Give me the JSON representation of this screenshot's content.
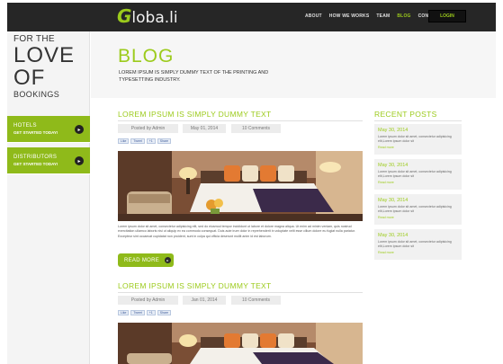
{
  "brand": {
    "logo_first": "G",
    "logo_rest": "loba.li"
  },
  "nav": {
    "items": [
      {
        "label": "ABOUT"
      },
      {
        "label": "HOW WE WORKS"
      },
      {
        "label": "TEAM"
      },
      {
        "label": "BLOG"
      },
      {
        "label": "CONTACT US"
      }
    ],
    "active": "BLOG",
    "login": "LOGIN"
  },
  "sidebar": {
    "line1": "FOR THE",
    "line2": "LOVE",
    "line3": "OF",
    "line4": "BOOKINGS",
    "buttons": [
      {
        "title": "HOTELS",
        "subtitle": "GET STARTED TODAY!",
        "icon": "arrow-right-icon"
      },
      {
        "title": "DISTRIBUTORS",
        "subtitle": "GET STARTED TODAY!",
        "icon": "arrow-right-icon"
      }
    ]
  },
  "header": {
    "title": "BLOG",
    "subtitle": "LOREM IPSUM IS SIMPLY DUMMY TEXT OF THE PRINTING AND TYPESETTING INDUSTRY."
  },
  "posts": [
    {
      "title": "LOREM IPSUM IS SIMPLY DUMMY TEXT",
      "author": "Posted by Admin",
      "date": "May 01, 2014",
      "comments": "10 Comments",
      "share": [
        "Like",
        "Tweet",
        "+1",
        "Share"
      ],
      "excerpt": "Lorem ipsum dolor sit amet, consectetur adipisicing elit, sed do eiusmod tempor incididunt ut labore et dolore magna aliqua. Ut enim ad minim veniam, quis nostrud exercitation ullamco laboris nisi ut aliquip ex ea commodo consequat. Duis aute irure dolor in reprehenderit in voluptate velit esse cillum dolore eu fugiat nulla pariatur. Excepteur sint occaecat cupidatat non proident, sunt in culpa qui officia deserunt mollit anim id est laborum.",
      "read_more": "READ MORE"
    },
    {
      "title": "LOREM IPSUM IS SIMPLY DUMMY TEXT",
      "author": "Posted by Admin",
      "date": "Jan 01, 2014",
      "comments": "10 Comments",
      "share": [
        "Like",
        "Tweet",
        "+1",
        "Share"
      ]
    }
  ],
  "recent": {
    "title": "RECENT POSTS",
    "items": [
      {
        "date": "May 30, 2014",
        "text": "Lorem ipsum dolor sit amet, consectetur adipisicing elit,Lorem ipsum dolor sit",
        "more": "Read more"
      },
      {
        "date": "May 30, 2014",
        "text": "Lorem ipsum dolor sit amet, consectetur adipisicing elit,Lorem ipsum dolor sit",
        "more": "Read more"
      },
      {
        "date": "May 30, 2014",
        "text": "Lorem ipsum dolor sit amet, consectetur adipisicing elit,Lorem ipsum dolor sit",
        "more": "Read more"
      },
      {
        "date": "May 30, 2014",
        "text": "Lorem ipsum dolor sit amet, consectetur adipisicing elit,Lorem ipsum dolor sit",
        "more": "Read more"
      }
    ]
  },
  "colors": {
    "accent": "#9ccb1c",
    "button": "#8fba1a",
    "topbar": "#262626"
  }
}
